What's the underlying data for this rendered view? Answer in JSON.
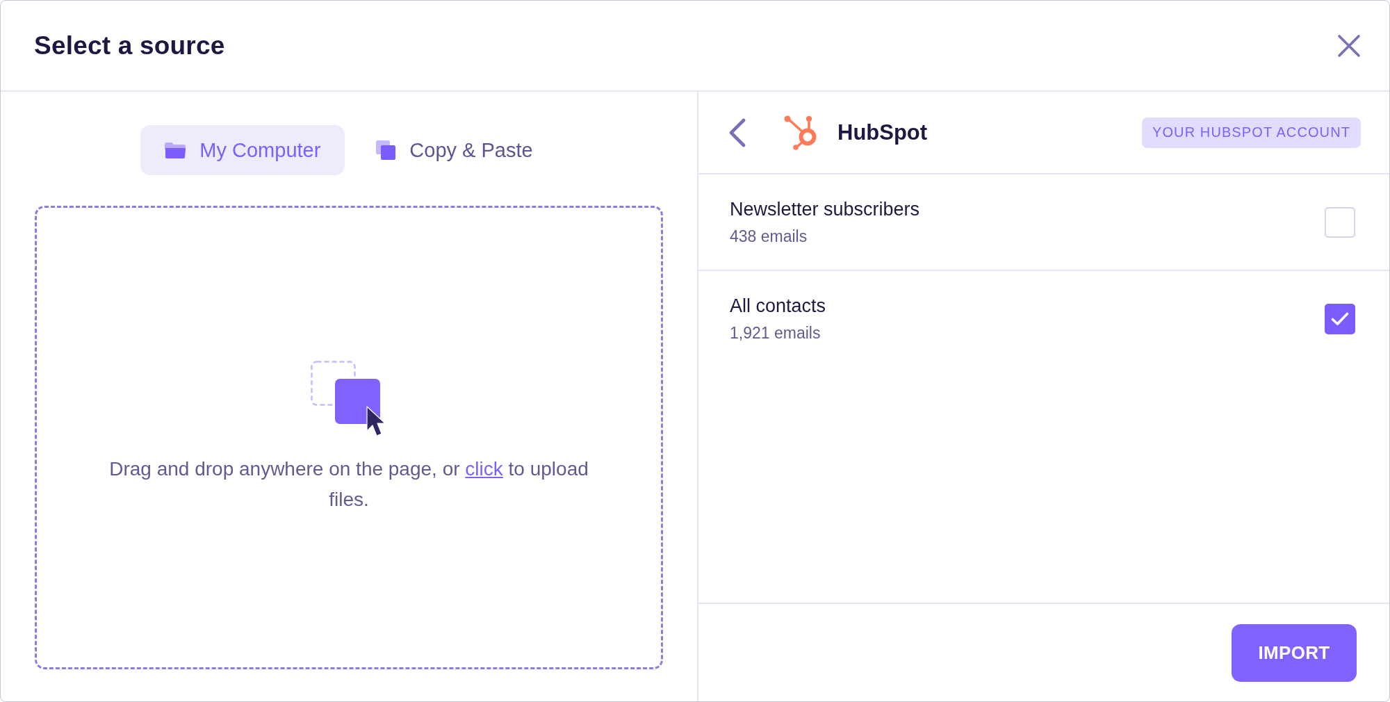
{
  "dialog": {
    "title": "Select a source"
  },
  "source_tabs": [
    {
      "kind": "upload",
      "label": "My Computer",
      "selected": true
    },
    {
      "kind": "paste",
      "label": "Copy & Paste",
      "selected": false
    }
  ],
  "dropzone": {
    "text_before": "Drag and drop anywhere on the page, or ",
    "link": "click",
    "text_after": " to upload files."
  },
  "integration": {
    "name": "HubSpot",
    "badge": "YOUR HUBSPOT ACCOUNT"
  },
  "lists": [
    {
      "name": "Newsletter subscribers",
      "count": "438 emails",
      "checked": false
    },
    {
      "name": "All contacts",
      "count": "1,921 emails",
      "checked": true
    }
  ],
  "footer": {
    "button": "IMPORT"
  }
}
